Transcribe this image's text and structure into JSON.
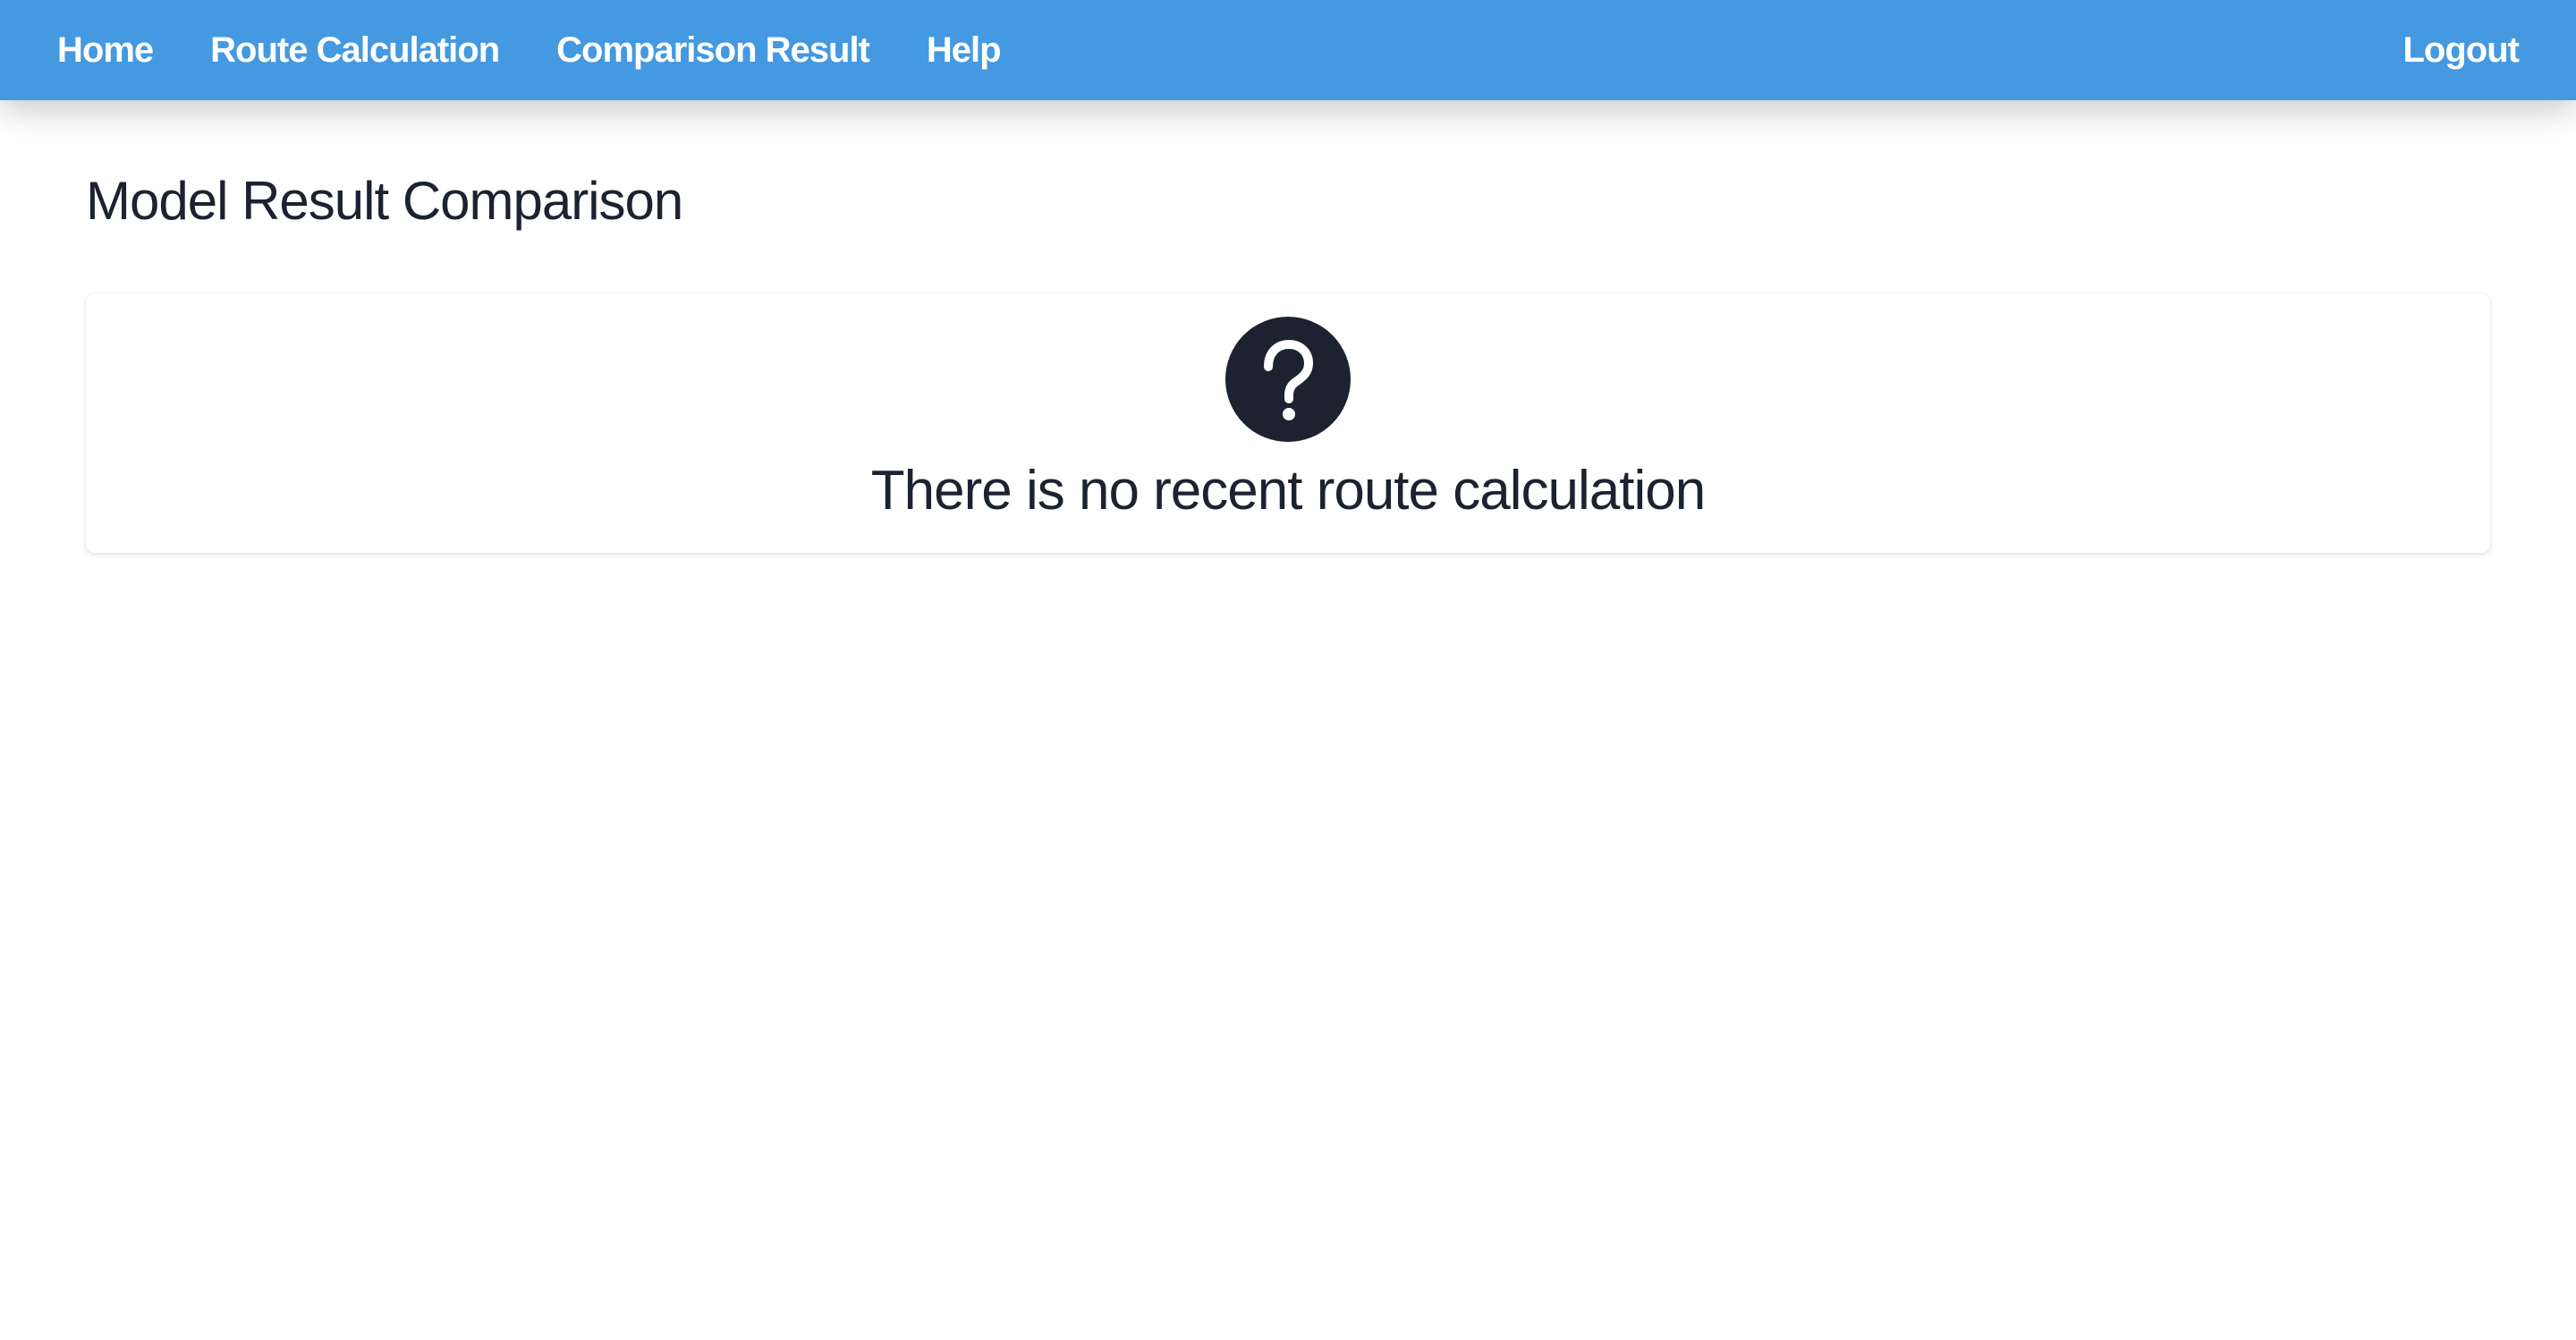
{
  "nav": {
    "items": [
      {
        "label": "Home"
      },
      {
        "label": "Route Calculation"
      },
      {
        "label": "Comparison Result"
      },
      {
        "label": "Help"
      }
    ],
    "logout_label": "Logout"
  },
  "page": {
    "title": "Model Result Comparison"
  },
  "empty_state": {
    "icon": "question-circle-icon",
    "message": "There is no recent route calculation"
  },
  "colors": {
    "navbar_bg": "#4499e1",
    "nav_text": "#ffffff",
    "text_dark": "#1c2230",
    "icon_bg": "#1c2230"
  }
}
